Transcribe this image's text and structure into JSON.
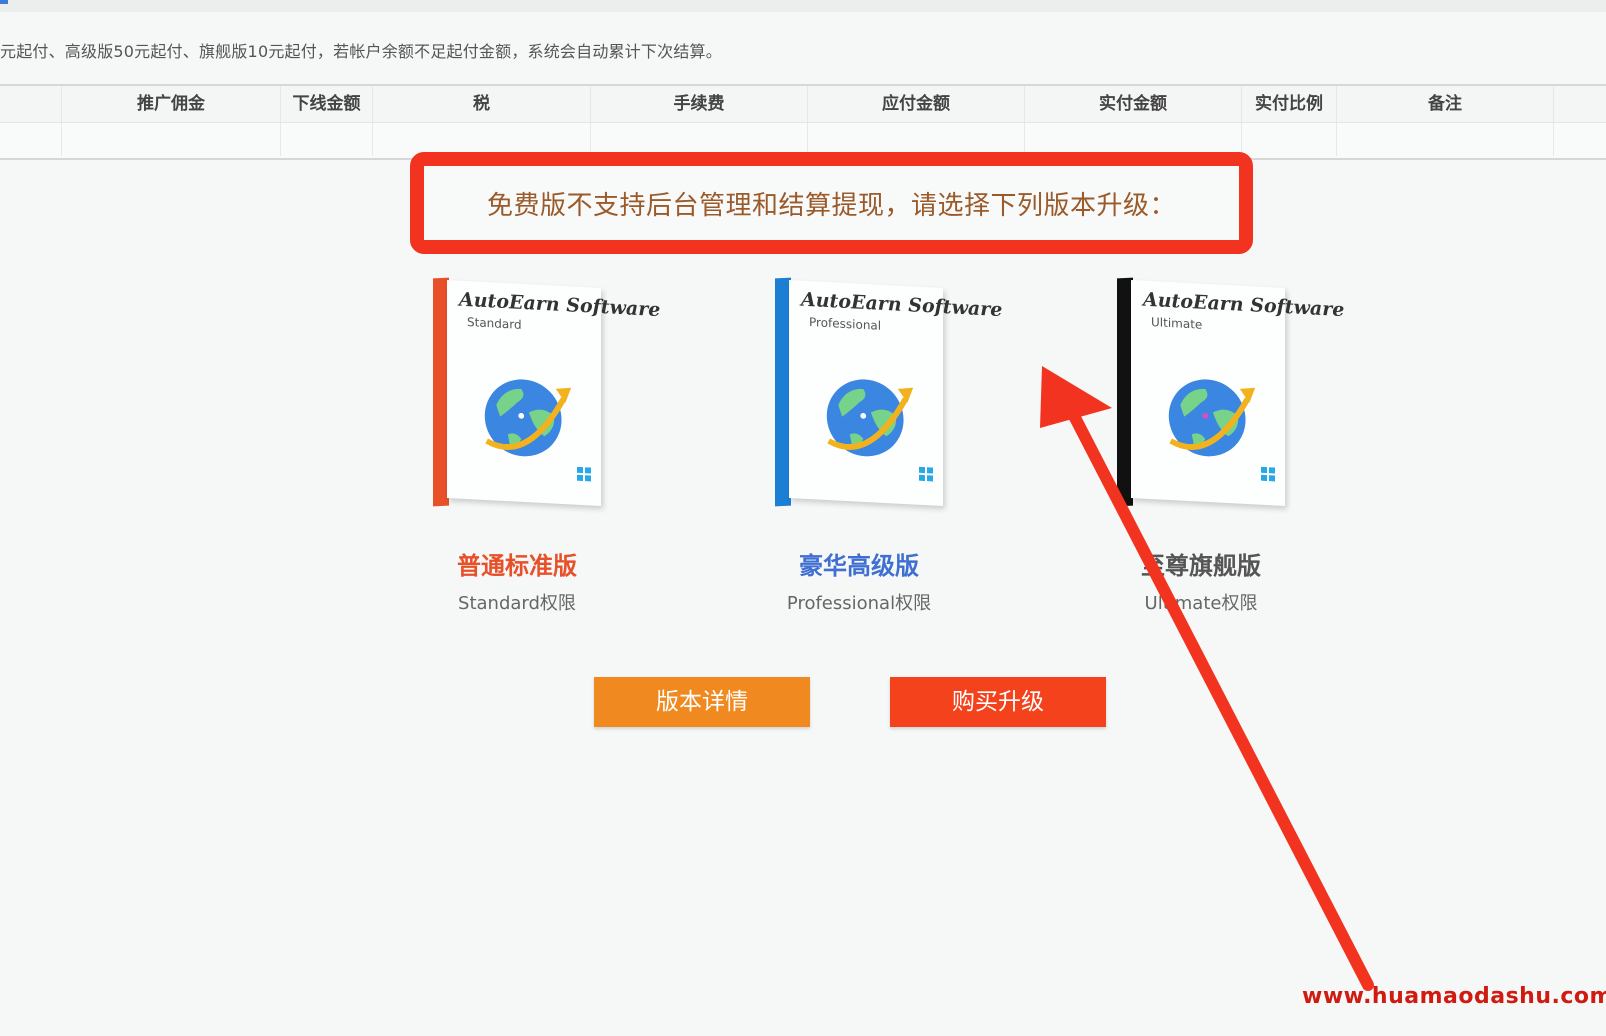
{
  "notice": "元起付、高级版50元起付、旗舰版10元起付，若帐户余额不足起付金额，系统会自动累计下次结算。",
  "table": {
    "headers": [
      "推广佣金",
      "下线金额",
      "税",
      "手续费",
      "应付金额",
      "实付金额",
      "实付比例",
      "备注"
    ]
  },
  "banner": "免费版不支持后台管理和结算提现，请选择下列版本升级：",
  "products": [
    {
      "brand": "AutoEarn Software",
      "edition": "Standard",
      "name": "普通标准版",
      "sub": "Standard权限",
      "name_color": "#e8502a",
      "spine_color": "#e8502a"
    },
    {
      "brand": "AutoEarn Software",
      "edition": "Professional",
      "name": "豪华高级版",
      "sub": "Professional权限",
      "name_color": "#3f6fd0",
      "spine_color": "#1b7fd4"
    },
    {
      "brand": "AutoEarn Software",
      "edition": "Ultimate",
      "name": "至尊旗舰版",
      "sub": "Ultimate权限",
      "name_color": "#555555",
      "spine_color": "#111111"
    }
  ],
  "buttons": {
    "detail": "版本详情",
    "buy": "购买升级"
  },
  "watermark": "www.huamaodashu.com",
  "colors": {
    "highlight": "#f2331f",
    "detail_button": "#f0891f",
    "buy_button": "#f4431c"
  }
}
